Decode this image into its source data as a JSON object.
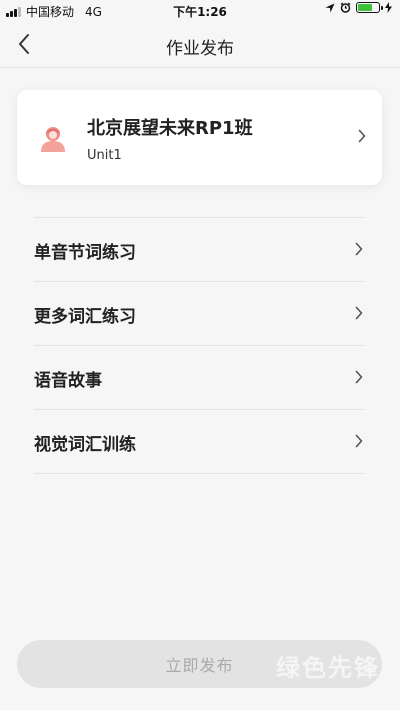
{
  "status_bar": {
    "carrier": "中国移动",
    "network": "4G",
    "time": "下午1:26",
    "battery_level": 0.7
  },
  "nav": {
    "title": "作业发布",
    "back_icon": "chevron-left-icon"
  },
  "class_card": {
    "name": "北京展望未来RP1班",
    "unit": "Unit1",
    "avatar_icon": "avatar-icon"
  },
  "practice_items": [
    {
      "label": "单音节词练习"
    },
    {
      "label": "更多词汇练习"
    },
    {
      "label": "语音故事"
    },
    {
      "label": "视觉词汇训练"
    }
  ],
  "publish_button": {
    "label": "立即发布"
  },
  "watermark": "绿色先锋",
  "colors": {
    "background": "#f6f6f6",
    "card": "#ffffff",
    "button_disabled": "#e3e3e3",
    "avatar": "#f08c86",
    "battery": "#3ec13a"
  }
}
